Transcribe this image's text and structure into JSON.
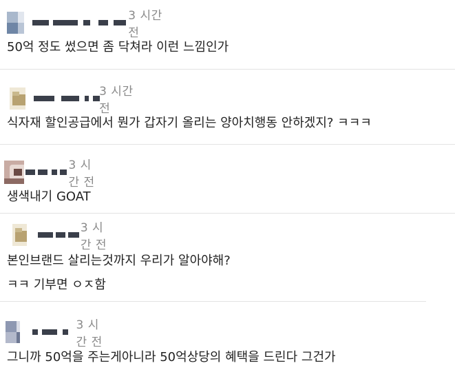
{
  "comments": [
    {
      "nickname_hidden": true,
      "time": "3 시간 전",
      "lines": [
        "50억 정도 썼으면 좀 닥쳐라 이런 느낌인가"
      ],
      "avatar_colors": [
        "#b7c4d4",
        "#7f93ad",
        "#d7dde6"
      ]
    },
    {
      "nickname_hidden": true,
      "time": "3 시간 전",
      "lines": [
        "식자재 할인공급에서 뭔가 갑자기 올리는 양아치행동 안하겠지? ㅋㅋㅋ"
      ],
      "avatar_colors": [
        "#c9b88c",
        "#a99263",
        "#efe8d6"
      ]
    },
    {
      "nickname_hidden": true,
      "time": "3 시간 전",
      "lines": [
        "생색내기 GOAT"
      ],
      "avatar_colors": [
        "#8a6b64",
        "#d9c2bb",
        "#5a3e3a"
      ]
    },
    {
      "nickname_hidden": true,
      "time": "3 시간 전",
      "lines": [
        "본인브랜드 살리는것까지 우리가 알아야해?",
        "ㅋㅋ 기부면 ㅇㅈ함"
      ],
      "avatar_colors": [
        "#c9b88c",
        "#a99263",
        "#efe8d6"
      ]
    },
    {
      "nickname_hidden": true,
      "time": "3 시간 전",
      "lines": [
        "그니까 50억을 주는게아니라 50억상당의 혜택을 드린다 그건가"
      ],
      "avatar_colors": [
        "#a8b0c4",
        "#6f7894",
        "#d8dbe5"
      ]
    }
  ]
}
